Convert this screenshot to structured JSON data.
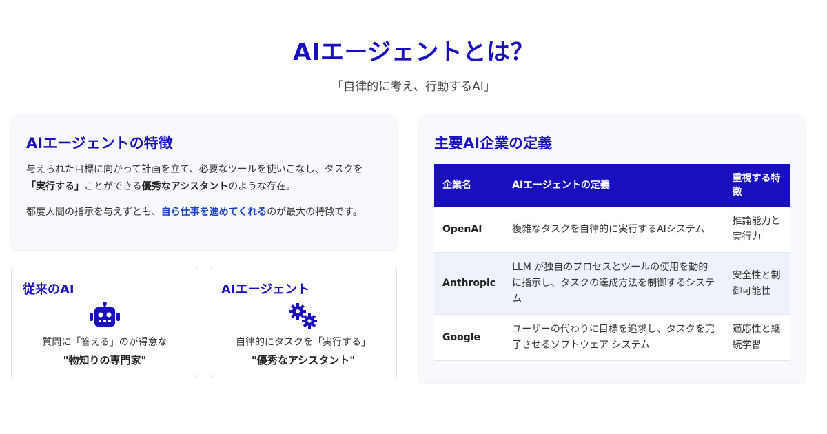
{
  "header": {
    "title": "AIエージェントとは？",
    "subtitle": "「自律的に考え、行動するAI」"
  },
  "features": {
    "title": "AIエージェントの特徴",
    "p1_a": "与えられた目標に向かって計画を立て、必要なツールを使いこなし、タスクを",
    "p1_b": "「実行する」",
    "p1_c": "ことができる",
    "p1_d": "優秀なアシスタント",
    "p1_e": "のような存在。",
    "p2_a": "都度人間の指示を与えずとも、",
    "p2_b": "自ら仕事を進めてくれる",
    "p2_c": "のが最大の特徴です。"
  },
  "compare": {
    "old": {
      "title": "従来のAI",
      "icon": "robot-icon",
      "desc": "質問に「答える」のが得意な",
      "emphasis": "\"物知りの専門家\""
    },
    "new": {
      "title": "AIエージェント",
      "icon": "gears-icon",
      "desc": "自律的にタスクを「実行する」",
      "emphasis": "\"優秀なアシスタント\""
    }
  },
  "definitions": {
    "title": "主要AI企業の定義",
    "headers": [
      "企業名",
      "AIエージェントの定義",
      "重視する特徴"
    ],
    "rows": [
      {
        "company": "OpenAI",
        "definition": "複雑なタスクを自律的に実行するAIシステム",
        "focus": "推論能力と実行力"
      },
      {
        "company": "Anthropic",
        "definition": "LLM が独自のプロセスとツールの使用を動的に指示し、タスクの達成方法を制御するシステム",
        "focus": "安全性と制御可能性"
      },
      {
        "company": "Google",
        "definition": "ユーザーの代わりに目標を追求し、タスクを完了させるソフトウェア システム",
        "focus": "適応性と継続学習"
      }
    ]
  },
  "colors": {
    "accent": "#1a0fbf",
    "highlight_blue": "#1a3fbf"
  }
}
